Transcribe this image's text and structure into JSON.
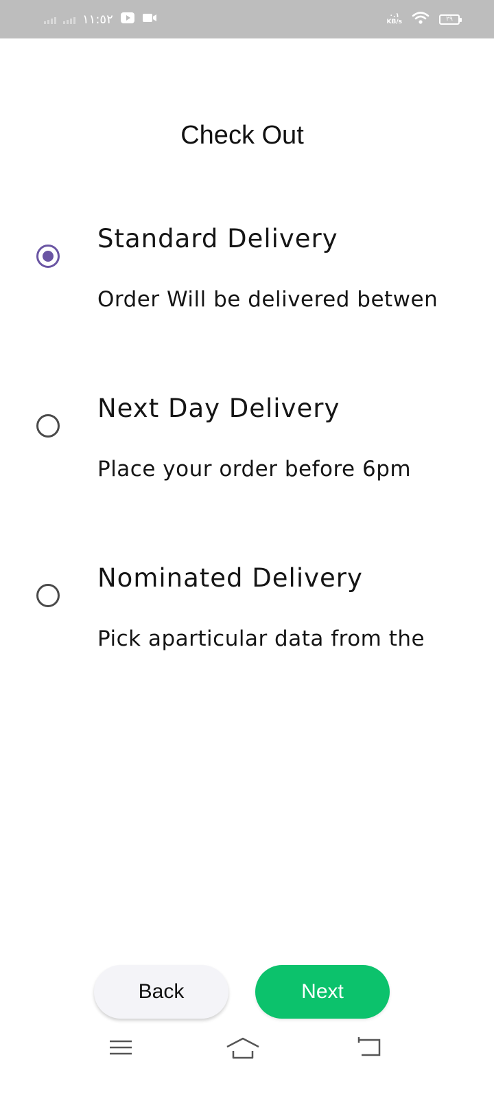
{
  "status_bar": {
    "time": "١١:٥٢",
    "speed_value": "٠.١",
    "speed_unit": "KB/s",
    "battery": "٢٩",
    "icons": [
      "signal-icon",
      "signal-icon",
      "youtube-icon",
      "video-camera-icon",
      "wifi-icon",
      "battery-icon"
    ]
  },
  "page": {
    "title": "Check Out"
  },
  "options": [
    {
      "title": "Standard Delivery",
      "description": "Order Will be delivered betwen",
      "selected": true
    },
    {
      "title": "Next Day Delivery",
      "description": "Place your order before 6pm",
      "selected": false
    },
    {
      "title": "Nominated Delivery",
      "description": "Pick aparticular data from the",
      "selected": false
    }
  ],
  "buttons": {
    "back_label": "Back",
    "next_label": "Next"
  },
  "nav_bar": {
    "icons": [
      "menu-icon",
      "home-icon",
      "back-icon"
    ]
  },
  "colors": {
    "accent": "#6a55a3",
    "next_button": "#0cc26c",
    "back_button": "#f4f4f8",
    "status_bar": "#bdbdbd"
  }
}
